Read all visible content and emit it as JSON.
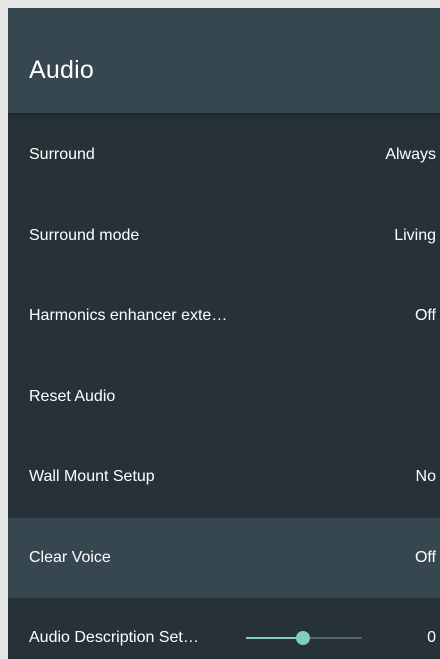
{
  "header": {
    "title": "Audio"
  },
  "settings": [
    {
      "label": "Surround",
      "value": "Always"
    },
    {
      "label": "Surround mode",
      "value": "Living"
    },
    {
      "label": "Harmonics enhancer exte…",
      "value": "Off"
    },
    {
      "label": "Reset Audio",
      "value": ""
    },
    {
      "label": "Wall Mount Setup",
      "value": "No"
    },
    {
      "label": "Clear Voice",
      "value": "Off",
      "focused": true
    },
    {
      "label": "Audio Description Set…",
      "value": "0",
      "slider_fraction": 0.49
    }
  ],
  "colors": {
    "background": "#263238",
    "header": "#37474f",
    "focused_row": "#37474f",
    "accent": "#80cbc4",
    "text": "#ffffff"
  }
}
